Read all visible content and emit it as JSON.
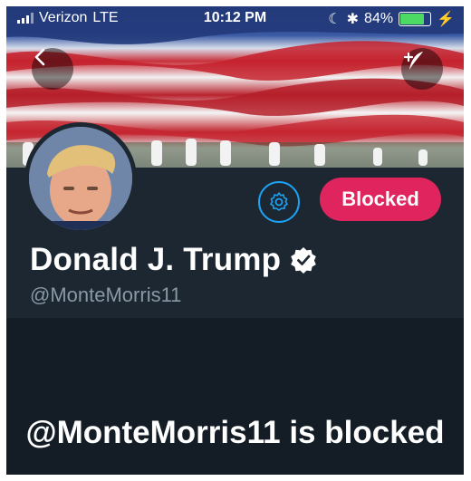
{
  "status_bar": {
    "carrier": "Verizon",
    "network": "LTE",
    "time": "10:12 PM",
    "battery": "84%",
    "battery_level": 0.84
  },
  "header": {
    "back_icon": "chevron-left-icon",
    "compose_icon": "compose-quill-icon"
  },
  "profile": {
    "name": "Donald J. Trump",
    "handle": "@MonteMorris11",
    "verified": true,
    "settings_icon": "gear-icon",
    "blocked_button_label": "Blocked"
  },
  "main": {
    "blocked_message": "@MonteMorris11 is blocked"
  },
  "colors": {
    "background": "#141d26",
    "profile_bg": "#1c2731",
    "accent_blue": "#1da1f2",
    "blocked_red": "#e0245e",
    "handle_gray": "#8899a6"
  }
}
